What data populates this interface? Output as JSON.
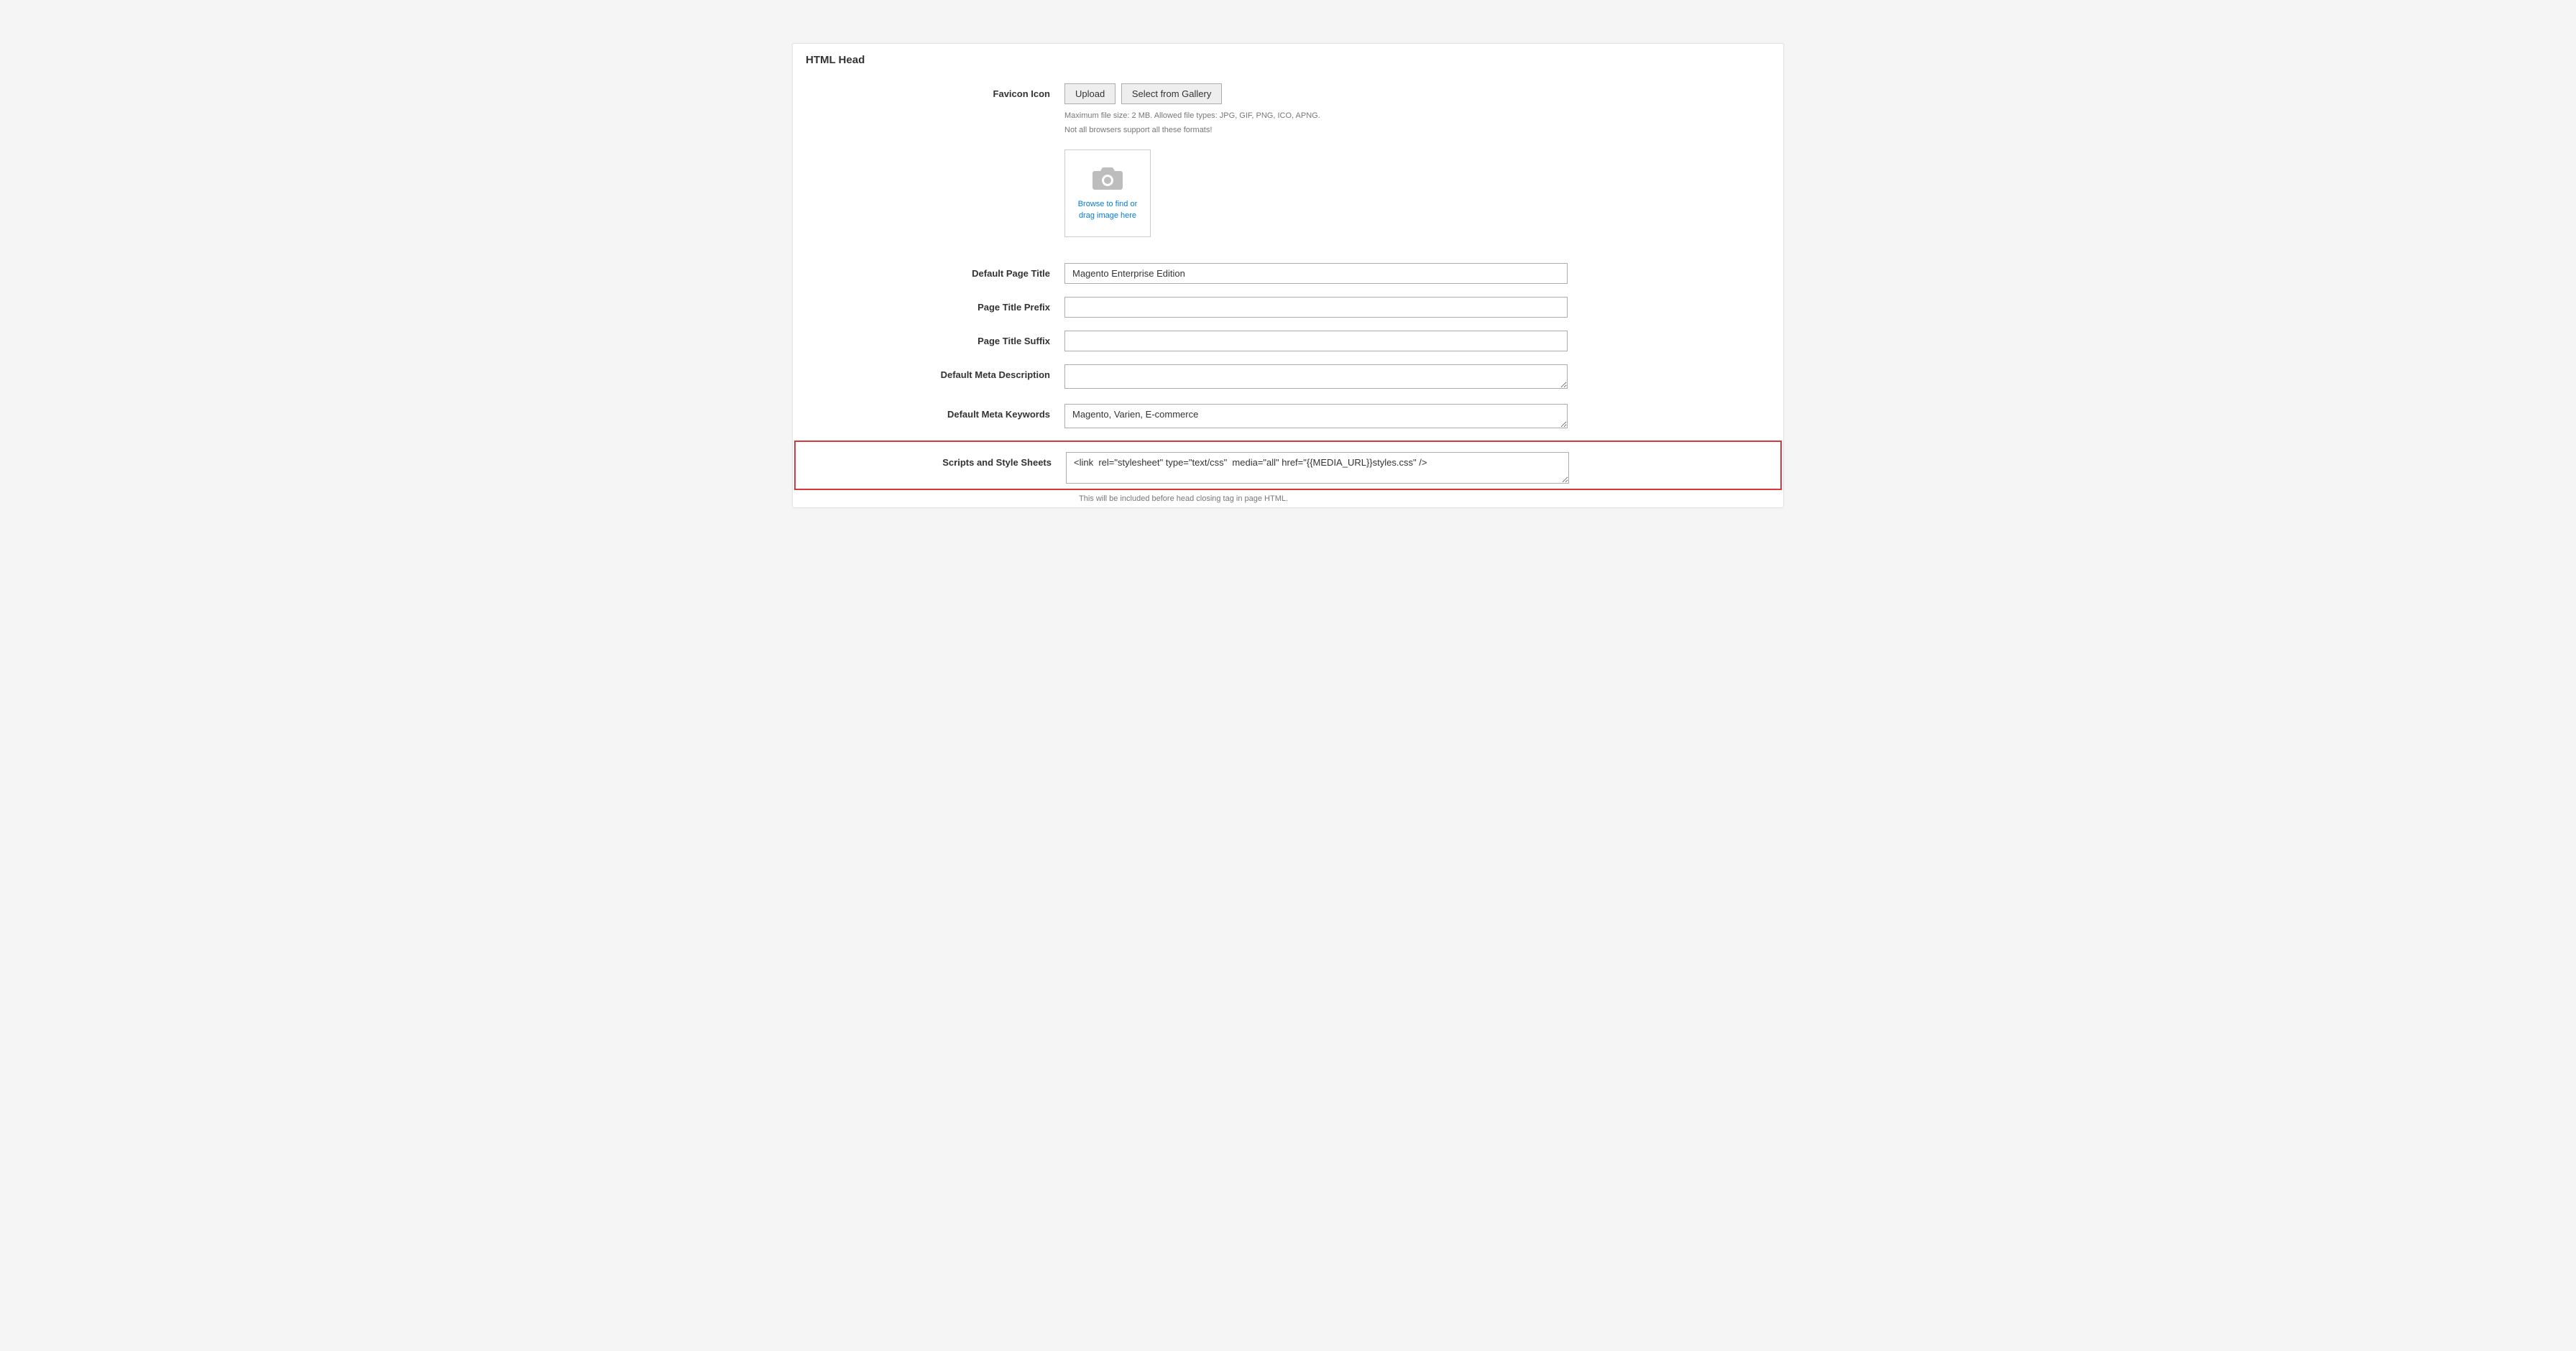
{
  "section": {
    "title": "HTML Head"
  },
  "favicon": {
    "label": "Favicon Icon",
    "uploadBtn": "Upload",
    "galleryBtn": "Select from Gallery",
    "hint1": "Maximum file size: 2 MB. Allowed file types: JPG, GIF, PNG, ICO, APNG.",
    "hint2": "Not all browsers support all these formats!",
    "browseLine1": "Browse to find or",
    "browseLine2": "drag image here"
  },
  "defaultTitle": {
    "label": "Default Page Title",
    "value": "Magento Enterprise Edition"
  },
  "titlePrefix": {
    "label": "Page Title Prefix",
    "value": ""
  },
  "titleSuffix": {
    "label": "Page Title Suffix",
    "value": ""
  },
  "metaDesc": {
    "label": "Default Meta Description",
    "value": ""
  },
  "metaKeywords": {
    "label": "Default Meta Keywords",
    "value": "Magento, Varien, E-commerce"
  },
  "scripts": {
    "label": "Scripts and Style Sheets",
    "value": "<link  rel=\"stylesheet\" type=\"text/css\"  media=\"all\" href=\"{{MEDIA_URL}}styles.css\" />",
    "hint": "This will be included before head closing tag in page HTML."
  }
}
